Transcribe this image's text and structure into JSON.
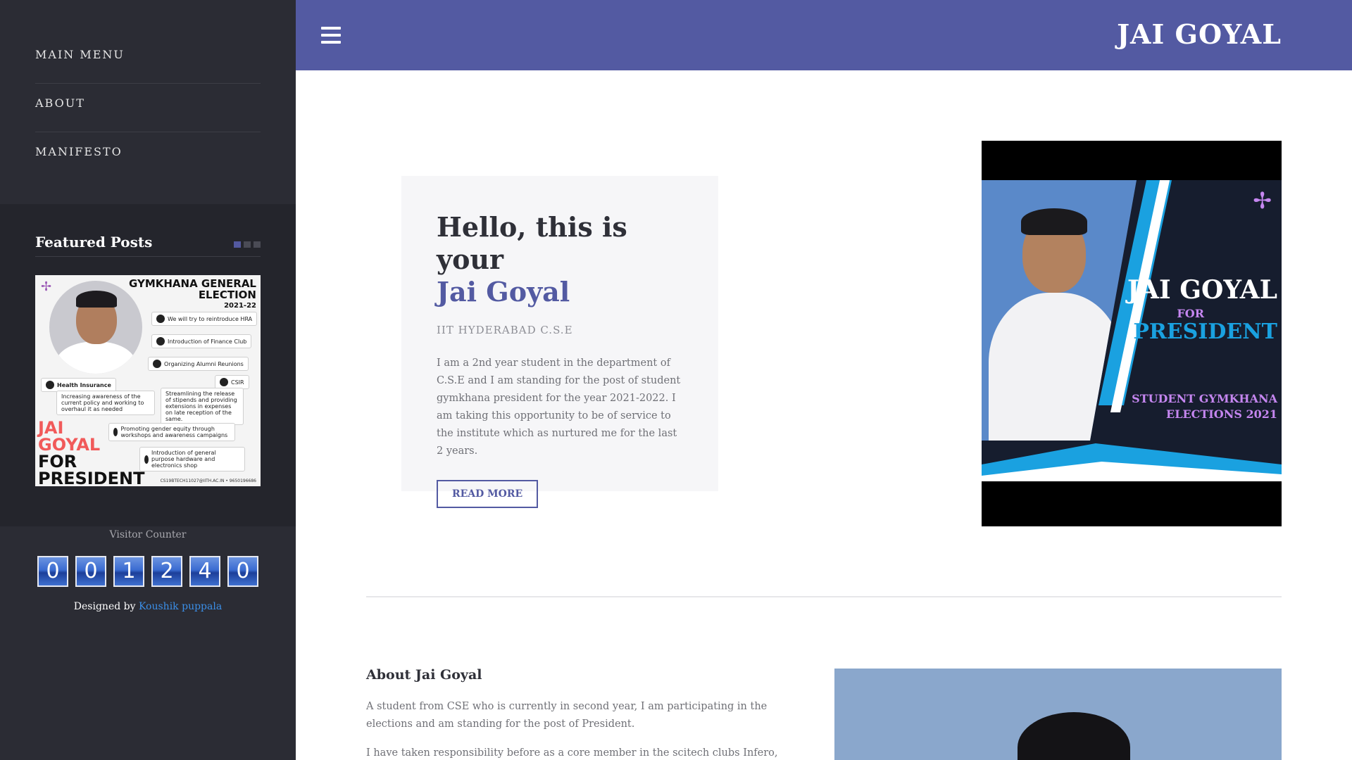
{
  "header": {
    "brand": "JAI GOYAL"
  },
  "sidebar": {
    "menu": [
      {
        "label": "MAIN MENU"
      },
      {
        "label": "ABOUT"
      },
      {
        "label": "MANIFESTO"
      }
    ],
    "featured": {
      "title": "Featured Posts",
      "poster": {
        "title_line1": "GYMKHANA GENERAL",
        "title_line2": "ELECTION",
        "title_year": "2021-22",
        "points": [
          "We will try to reintroduce HRA",
          "Introduction of Finance Club",
          "Organizing Alumni Reunions",
          "CSIR",
          "Health Insurance",
          "Increasing awareness of the current policy and working to overhaul it as needed",
          "Streamlining the release of stipends and providing extensions in expenses on late reception of the same.",
          "Promoting gender equity through workshops and awareness campaigns",
          "Introduction of general purpose hardware and electronics shop"
        ],
        "big_red": "JAI GOYAL",
        "big_black": "FOR PRESIDENT",
        "footer": "CS19BTECH11027@IITH.AC.IN • 9650196686"
      }
    },
    "counter": {
      "label": "Visitor Counter",
      "digits": [
        "0",
        "0",
        "1",
        "2",
        "4",
        "0"
      ]
    },
    "designed_by": {
      "prefix": "Designed by",
      "name": "Koushik puppala"
    }
  },
  "hero": {
    "title_line1": "Hello, this is your",
    "title_line2": "Jai Goyal",
    "subtitle": "IIT HYDERABAD C.S.E",
    "body": "I am a 2nd year student in the department of C.S.E and I am standing for the post of student gymkhana president for the year 2021-2022. I am taking this opportunity to be of service to the institute which as nurtured me for the last 2 years.",
    "button": "READ MORE",
    "poster": {
      "name": "JAI GOYAL",
      "for": "FOR",
      "role": "PRESIDENT",
      "event_line1": "STUDENT GYMKHANA",
      "event_line2": "ELECTIONS 2021"
    }
  },
  "about": {
    "title": "About Jai Goyal",
    "p1": "A student from CSE who is currently in second year, I am participating in the elections and am standing for the post of President.",
    "p2": "I have taken responsibility before as a core member in the scitech clubs Infero, Lambda,"
  },
  "colors": {
    "accent": "#535aa2",
    "sidebar": "#2b2c34",
    "link": "#3b8fe8"
  },
  "icons": {
    "menu_toggle": "hamburger-icon",
    "slider_dots": "slider-dot-icon"
  }
}
